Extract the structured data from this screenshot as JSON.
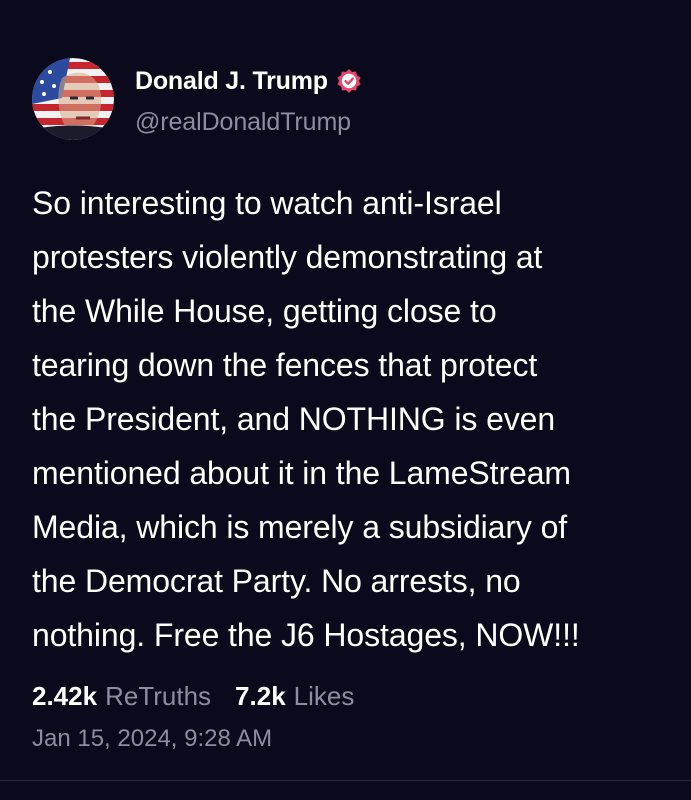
{
  "author": {
    "display_name": "Donald J. Trump",
    "handle": "@realDonaldTrump",
    "avatar_icon": "flag-portrait-avatar",
    "verified_icon": "verified-badge-icon",
    "verified_color": "#e8456b"
  },
  "post": {
    "text": "So interesting to watch anti-Israel\nprotesters violently demonstrating at\nthe While House, getting close to\ntearing down the fences that protect\nthe President, and NOTHING is even\nmentioned about it in the LameStream\nMedia, which is merely a subsidiary of\nthe Democrat Party. No arrests, no\nnothing. Free the J6 Hostages, NOW!!!"
  },
  "stats": {
    "retruths_count": "2.42k",
    "retruths_label": "ReTruths",
    "likes_count": "7.2k",
    "likes_label": "Likes"
  },
  "timestamp": "Jan 15, 2024, 9:28 AM",
  "colors": {
    "background": "#0b0a1c",
    "muted_text": "#8e8c9e",
    "primary_text": "#ffffff"
  }
}
